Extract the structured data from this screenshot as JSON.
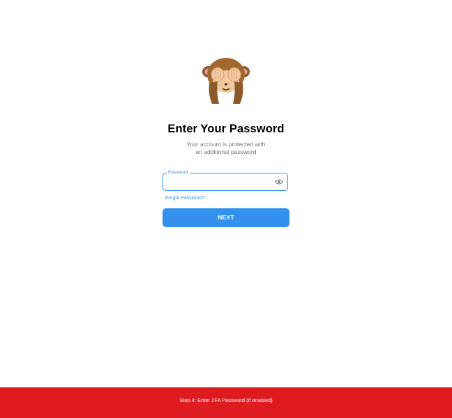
{
  "illustration": {
    "icon": "see-no-evil-monkey-icon"
  },
  "title": "Enter Your Password",
  "subtitle": {
    "line1": "Your account is protected with",
    "line2": "an additional password"
  },
  "password_field": {
    "label": "Password",
    "value": "",
    "toggle_icon": "eye-icon"
  },
  "forgot_link": "Forgot Password?",
  "next_button": "NEXT",
  "banner": {
    "text": "Step 4: Enter 2FA Password (if enabled)",
    "color": "#de1b1f"
  },
  "colors": {
    "accent": "#3390ec",
    "title": "#000000",
    "subtitle": "#707579"
  }
}
